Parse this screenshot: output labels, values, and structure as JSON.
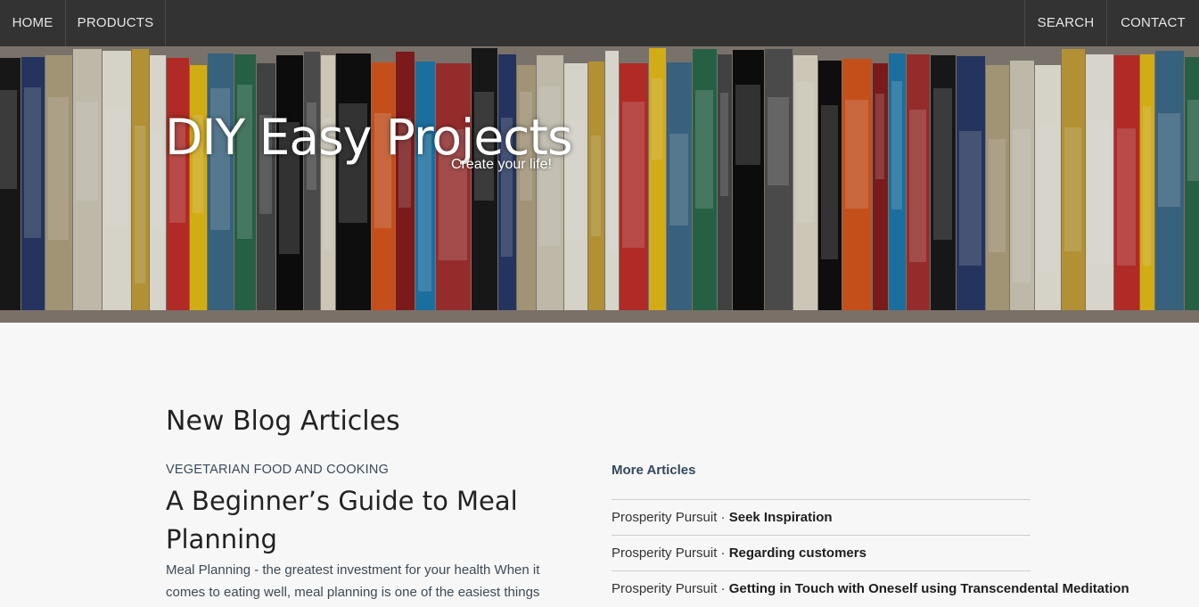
{
  "nav": {
    "home": "HOME",
    "products": "PRODUCTS",
    "search": "SEARCH",
    "contact": "CONTACT"
  },
  "hero": {
    "title": "DIY Easy Projects",
    "subtitle": "Create your life!"
  },
  "blog": {
    "heading": "New Blog Articles",
    "featured": {
      "category": "VEGETARIAN FOOD AND COOKING",
      "title": "A Beginner’s Guide to Meal Planning",
      "excerpt": "Meal Planning - the greatest investment for your health When it comes to eating well, meal planning is one of the easiest things"
    },
    "more_heading": "More Articles",
    "more_articles": [
      {
        "source": "Prosperity Pursuit",
        "title": "Seek Inspiration"
      },
      {
        "source": "Prosperity Pursuit",
        "title": "Regarding customers"
      },
      {
        "source": "Prosperity Pursuit",
        "title": "Getting in Touch with Oneself using Transcendental Meditation"
      }
    ]
  }
}
